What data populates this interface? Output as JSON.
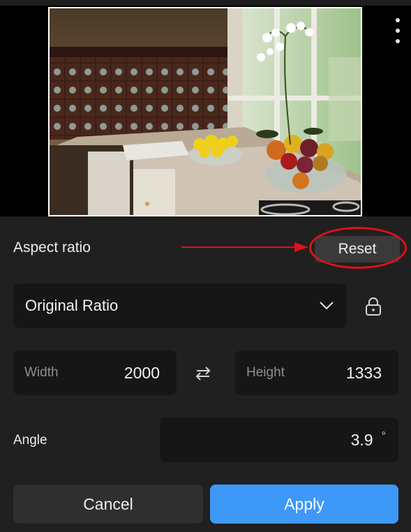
{
  "preview": {
    "image_alt": "Kitchen counter with bowls of lemons and fruit by a window with white orchids"
  },
  "menu": {
    "icon": "more-vertical-icon"
  },
  "aspect": {
    "label": "Aspect ratio",
    "reset_label": "Reset",
    "selected_ratio": "Original Ratio"
  },
  "dimensions": {
    "width_label": "Width",
    "width_value": "2000",
    "height_label": "Height",
    "height_value": "1333"
  },
  "angle": {
    "label": "Angle",
    "value": "3.9",
    "unit": "°"
  },
  "actions": {
    "cancel_label": "Cancel",
    "apply_label": "Apply"
  },
  "colors": {
    "background": "#202020",
    "field": "#161616",
    "apply": "#3d98f8",
    "annotation": "#e0101a"
  }
}
